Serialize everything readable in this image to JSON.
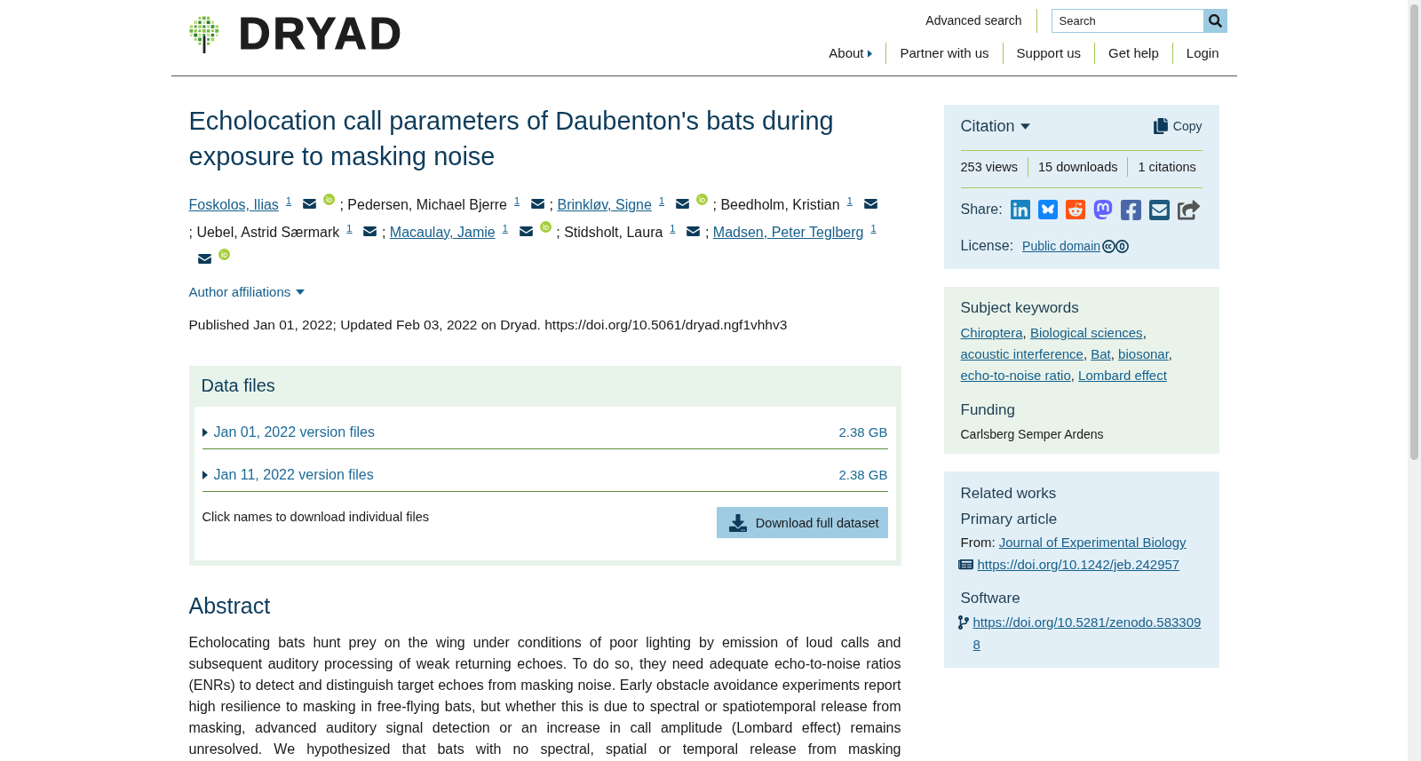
{
  "header": {
    "logo_text": "DRYAD",
    "advanced_search": "Advanced search",
    "search": {
      "placeholder": "Search"
    },
    "nav": [
      {
        "label": "About",
        "kind": "menu"
      },
      {
        "label": "Partner with us",
        "kind": "link"
      },
      {
        "label": "Support us",
        "kind": "link"
      },
      {
        "label": "Get help",
        "kind": "link"
      },
      {
        "label": "Login",
        "kind": "link"
      }
    ]
  },
  "dataset": {
    "title": "Echolocation call parameters of Daubenton's bats during exposure to masking noise",
    "authors": [
      {
        "name": "Foskolos, Ilias",
        "kind": "link",
        "affiliation": "1",
        "email": true,
        "orcid": true
      },
      {
        "separator": ";",
        "name": "Pedersen, Michael Bjerre",
        "kind": "plain",
        "affiliation": "1",
        "email": true,
        "orcid": false
      },
      {
        "separator": ";",
        "name": "Brinkløv, Signe",
        "kind": "link",
        "affiliation": "1",
        "email": true,
        "orcid": true
      },
      {
        "separator": ";",
        "name": "Beedholm, Kristian",
        "kind": "plain",
        "affiliation": "1",
        "email": true,
        "orcid": false
      },
      {
        "separator": ";",
        "name": "Uebel, Astrid Særmark",
        "kind": "plain",
        "affiliation": "1",
        "email": true,
        "orcid": false
      },
      {
        "separator": ";",
        "name": "Macaulay, Jamie",
        "kind": "link",
        "affiliation": "1",
        "email": true,
        "orcid": true
      },
      {
        "separator": ";",
        "name": "Stidsholt, Laura",
        "kind": "plain",
        "affiliation": "1",
        "email": true,
        "orcid": false
      },
      {
        "separator": ";",
        "name": "Madsen, Peter Teglberg",
        "kind": "link",
        "affiliation": "1",
        "email": true,
        "orcid": true
      }
    ],
    "affiliations": {
      "label": "Author affiliations",
      "expanded": false
    },
    "published": "Published Jan 01, 2022; Updated Feb 03, 2022 on Dryad. https://doi.org/10.5061/dryad.ngf1vhhv3"
  },
  "data_files": {
    "heading": "Data files",
    "versions": [
      {
        "label": "Jan 01, 2022 version files",
        "size": "2.38 GB",
        "expanded": false
      },
      {
        "label": "Jan 11, 2022 version files",
        "size": "2.38 GB",
        "expanded": false
      }
    ],
    "note": "Click names to download individual files",
    "download_button": "Download full dataset"
  },
  "abstract": {
    "heading": "Abstract",
    "text": "Echolocating bats hunt prey on the wing under conditions of poor lighting by emission of loud calls and subsequent auditory processing of weak returning echoes. To do so, they need adequate echo-to-noise ratios (ENRs) to detect and distinguish target echoes from masking noise. Early obstacle avoidance experiments report high resilience to masking in free-flying bats, but whether this is due to spectral or spatiotemporal release from masking, advanced auditory signal detection or an increase in call amplitude (Lombard effect) remains unresolved. We hypothesized that bats with no spectral, spatial or temporal release from masking"
  },
  "citation": {
    "label": "Citation",
    "expanded": false,
    "copy": "Copy",
    "stats": [
      "253 views",
      "15 downloads",
      "1 citations"
    ],
    "share_label": "Share:",
    "license_label": "License:",
    "license": "Public domain"
  },
  "keywords": {
    "heading": "Subject keywords",
    "items": [
      {
        "label": "Chiroptera",
        "separator": ","
      },
      {
        "label": "Biological sciences",
        "separator": ","
      },
      {
        "label": "acoustic interference",
        "separator": ","
      },
      {
        "label": "Bat",
        "separator": ","
      },
      {
        "label": "biosonar",
        "separator": ","
      },
      {
        "label": "echo-to-noise ratio",
        "separator": ","
      },
      {
        "label": "Lombard effect"
      }
    ]
  },
  "funding": {
    "heading": "Funding",
    "funders": [
      "Carlsberg Semper Ardens"
    ]
  },
  "related_works": {
    "heading": "Related works",
    "groups": [
      {
        "heading": "Primary article",
        "source_label": "From:",
        "source": "Journal of Experimental Biology",
        "links": [
          {
            "kind": "article",
            "url": "https://doi.org/10.1242/jeb.242957"
          }
        ]
      },
      {
        "heading": "Software",
        "links": [
          {
            "kind": "software",
            "url": "https://doi.org/10.5281/zenodo.5833098"
          }
        ]
      }
    ]
  }
}
